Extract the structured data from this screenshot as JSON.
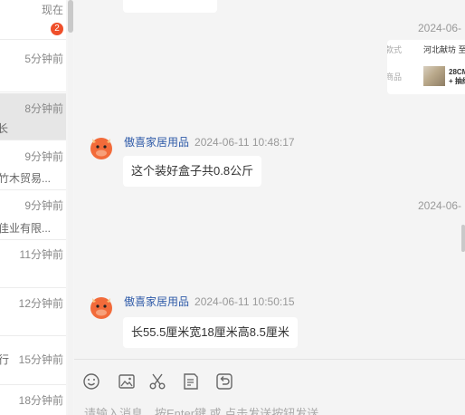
{
  "conversations": [
    {
      "time": "现在",
      "snippet": "",
      "badge": "2",
      "active": false
    },
    {
      "time": "5分钟前",
      "snippet": "",
      "badge": "",
      "active": false
    },
    {
      "time": "8分钟前",
      "snippet": "长",
      "badge": "",
      "active": true
    },
    {
      "time": "9分钟前",
      "snippet": "竹木贸易...",
      "badge": "",
      "active": false
    },
    {
      "time": "9分钟前",
      "snippet": "佳业有限...",
      "badge": "",
      "active": false
    },
    {
      "time": "11分钟前",
      "snippet": "",
      "badge": "",
      "active": false
    },
    {
      "time": "12分钟前",
      "snippet": "",
      "badge": "",
      "active": false
    },
    {
      "time": "15分钟前",
      "snippet": "行",
      "badge": "",
      "active": false
    },
    {
      "time": "18分钟前",
      "snippet": "",
      "badge": "",
      "active": false
    }
  ],
  "chat": {
    "time_right_1": "2024-06-",
    "time_right_2": "2024-06-",
    "order_card": {
      "label1": "款式",
      "value1": "河北献坊 至",
      "label2": "商品",
      "product_line1": "28CM",
      "product_line2": "+ 抽纸"
    },
    "messages": [
      {
        "sender": "傲喜家居用品",
        "timestamp": "2024-06-11 10:48:17",
        "text": "这个装好盒子共0.8公斤"
      },
      {
        "sender": "傲喜家居用品",
        "timestamp": "2024-06-11 10:50:15",
        "text": "长55.5厘米宽18厘米高8.5厘米"
      }
    ],
    "input_placeholder": "请输入消息，按Enter键 或 点击发送按钮发送"
  },
  "toolbar": {
    "icons": [
      "emoji-icon",
      "image-icon",
      "scissors-icon",
      "order-icon",
      "history-icon"
    ]
  },
  "colors": {
    "badge": "#ef4f2a",
    "sender_name": "#2e5aa8",
    "avatar": "#f26b3a"
  }
}
